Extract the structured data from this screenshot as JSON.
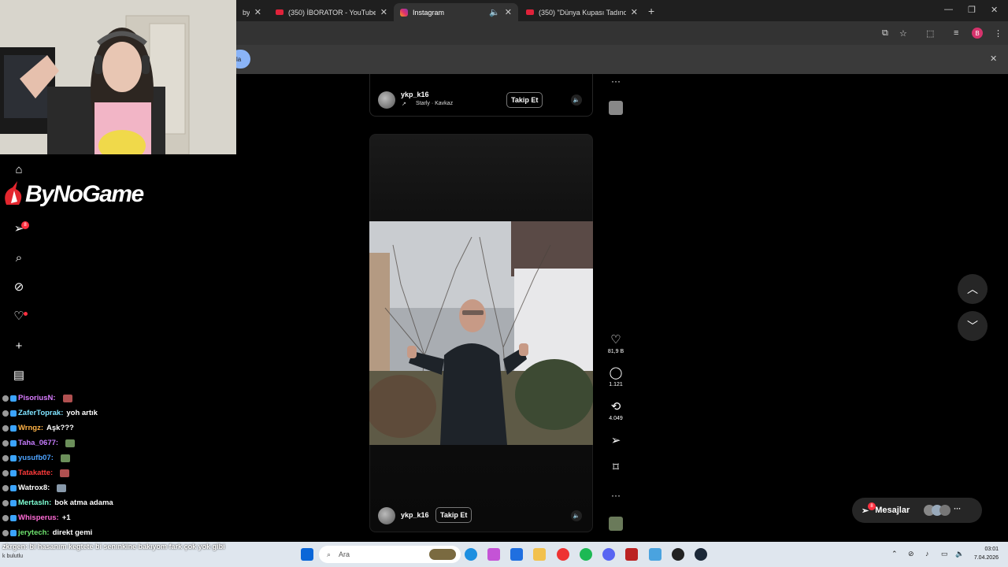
{
  "browser": {
    "tabs": [
      {
        "label": "by-it",
        "kind": "other",
        "active": false
      },
      {
        "label": "(350) İBORATOR - YouTube",
        "kind": "yt",
        "active": false
      },
      {
        "label": "Instagram",
        "kind": "ig",
        "active": true
      },
      {
        "label": "(350) \"Dünya Kupası Tadında E",
        "kind": "yt",
        "active": false
      }
    ],
    "new_tab_label": "+",
    "info_button_label": "la"
  },
  "post_top": {
    "username": "ykp_k16",
    "music": "Starly · Kavkaz",
    "follow_label": "Takip Et"
  },
  "reel": {
    "username": "ykp_k16",
    "follow_label": "Takip Et",
    "likes": "81,9 B",
    "comments": "1.121",
    "reposts": "4.049"
  },
  "messages": {
    "label": "Mesajlar",
    "badge": "8"
  },
  "ig_sidebar": {
    "notif_badge": "8"
  },
  "stream": {
    "logo_text": "ByNoGame",
    "chat": [
      {
        "user": "PisoriusN:",
        "color": "#d97cff",
        "msg": "",
        "emote": "#b05050"
      },
      {
        "user": "ZaferToprak:",
        "color": "#7fe3ff",
        "msg": "yoh artık",
        "emote": ""
      },
      {
        "user": "Wrngz:",
        "color": "#ffb347",
        "msg": "Aşk???",
        "emote": ""
      },
      {
        "user": "Taha_0677:",
        "color": "#c77dff",
        "msg": "",
        "emote": "#6b8f5a"
      },
      {
        "user": "yusufb07:",
        "color": "#4da3ff",
        "msg": "",
        "emote": "#6b8f5a"
      },
      {
        "user": "Tatakatte:",
        "color": "#ff3b3b",
        "msg": "",
        "emote": "#b05050"
      },
      {
        "user": "Watrox8:",
        "color": "#ffffff",
        "msg": "",
        "emote": "#8899aa"
      },
      {
        "user": "MertasIn:",
        "color": "#7fffd4",
        "msg": "bok atma adama",
        "emote": ""
      },
      {
        "user": "Whisperus:",
        "color": "#ff6bd6",
        "msg": "+1",
        "emote": ""
      },
      {
        "user": "jerytech:",
        "color": "#6ee36e",
        "msg": "direkt gemi",
        "emote": ""
      }
    ],
    "bottom_msg": "zkrgen: bi hasanım kegtete bi senınkine bakıyom fark çok yok gibi",
    "bottom_sub": "k bulutlu"
  },
  "taskbar": {
    "search_placeholder": "Ara",
    "time": "03:01",
    "date": "7.04.2026"
  }
}
